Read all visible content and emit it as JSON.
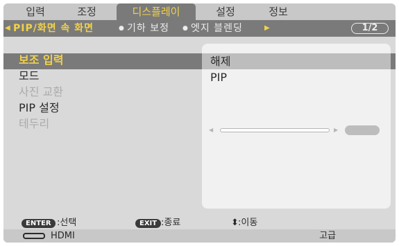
{
  "tabs": [
    {
      "label": "입력"
    },
    {
      "label": "조정"
    },
    {
      "label": "디스플레이",
      "active": true
    },
    {
      "label": "설정"
    },
    {
      "label": "정보"
    }
  ],
  "breadcrumb": {
    "current": "PIP/화면 속 화면",
    "items": [
      "기하 보정",
      "엣지 블렌딩"
    ],
    "page": "1/2"
  },
  "menu_items": [
    {
      "label": "보조 입력",
      "state": "selected"
    },
    {
      "label": "모드",
      "state": "normal"
    },
    {
      "label": "사진 교환",
      "state": "disabled"
    },
    {
      "label": "PIP 설정",
      "state": "normal"
    },
    {
      "label": "테두리",
      "state": "disabled"
    }
  ],
  "options": [
    "해제",
    "PIP"
  ],
  "footer": {
    "enter_key": "ENTER",
    "enter_label": ":선택",
    "exit_key": "EXIT",
    "exit_label": ":종료",
    "move_icon": "up-down-arrow-icon",
    "move_label": ":이동"
  },
  "status": {
    "source_icon": "hdmi-connector-icon",
    "source": "HDMI",
    "level": "고급"
  },
  "colors": {
    "highlight": "#f2d24a",
    "active_bg": "#7a7a7a",
    "panel_bg": "#d9d9d9"
  }
}
